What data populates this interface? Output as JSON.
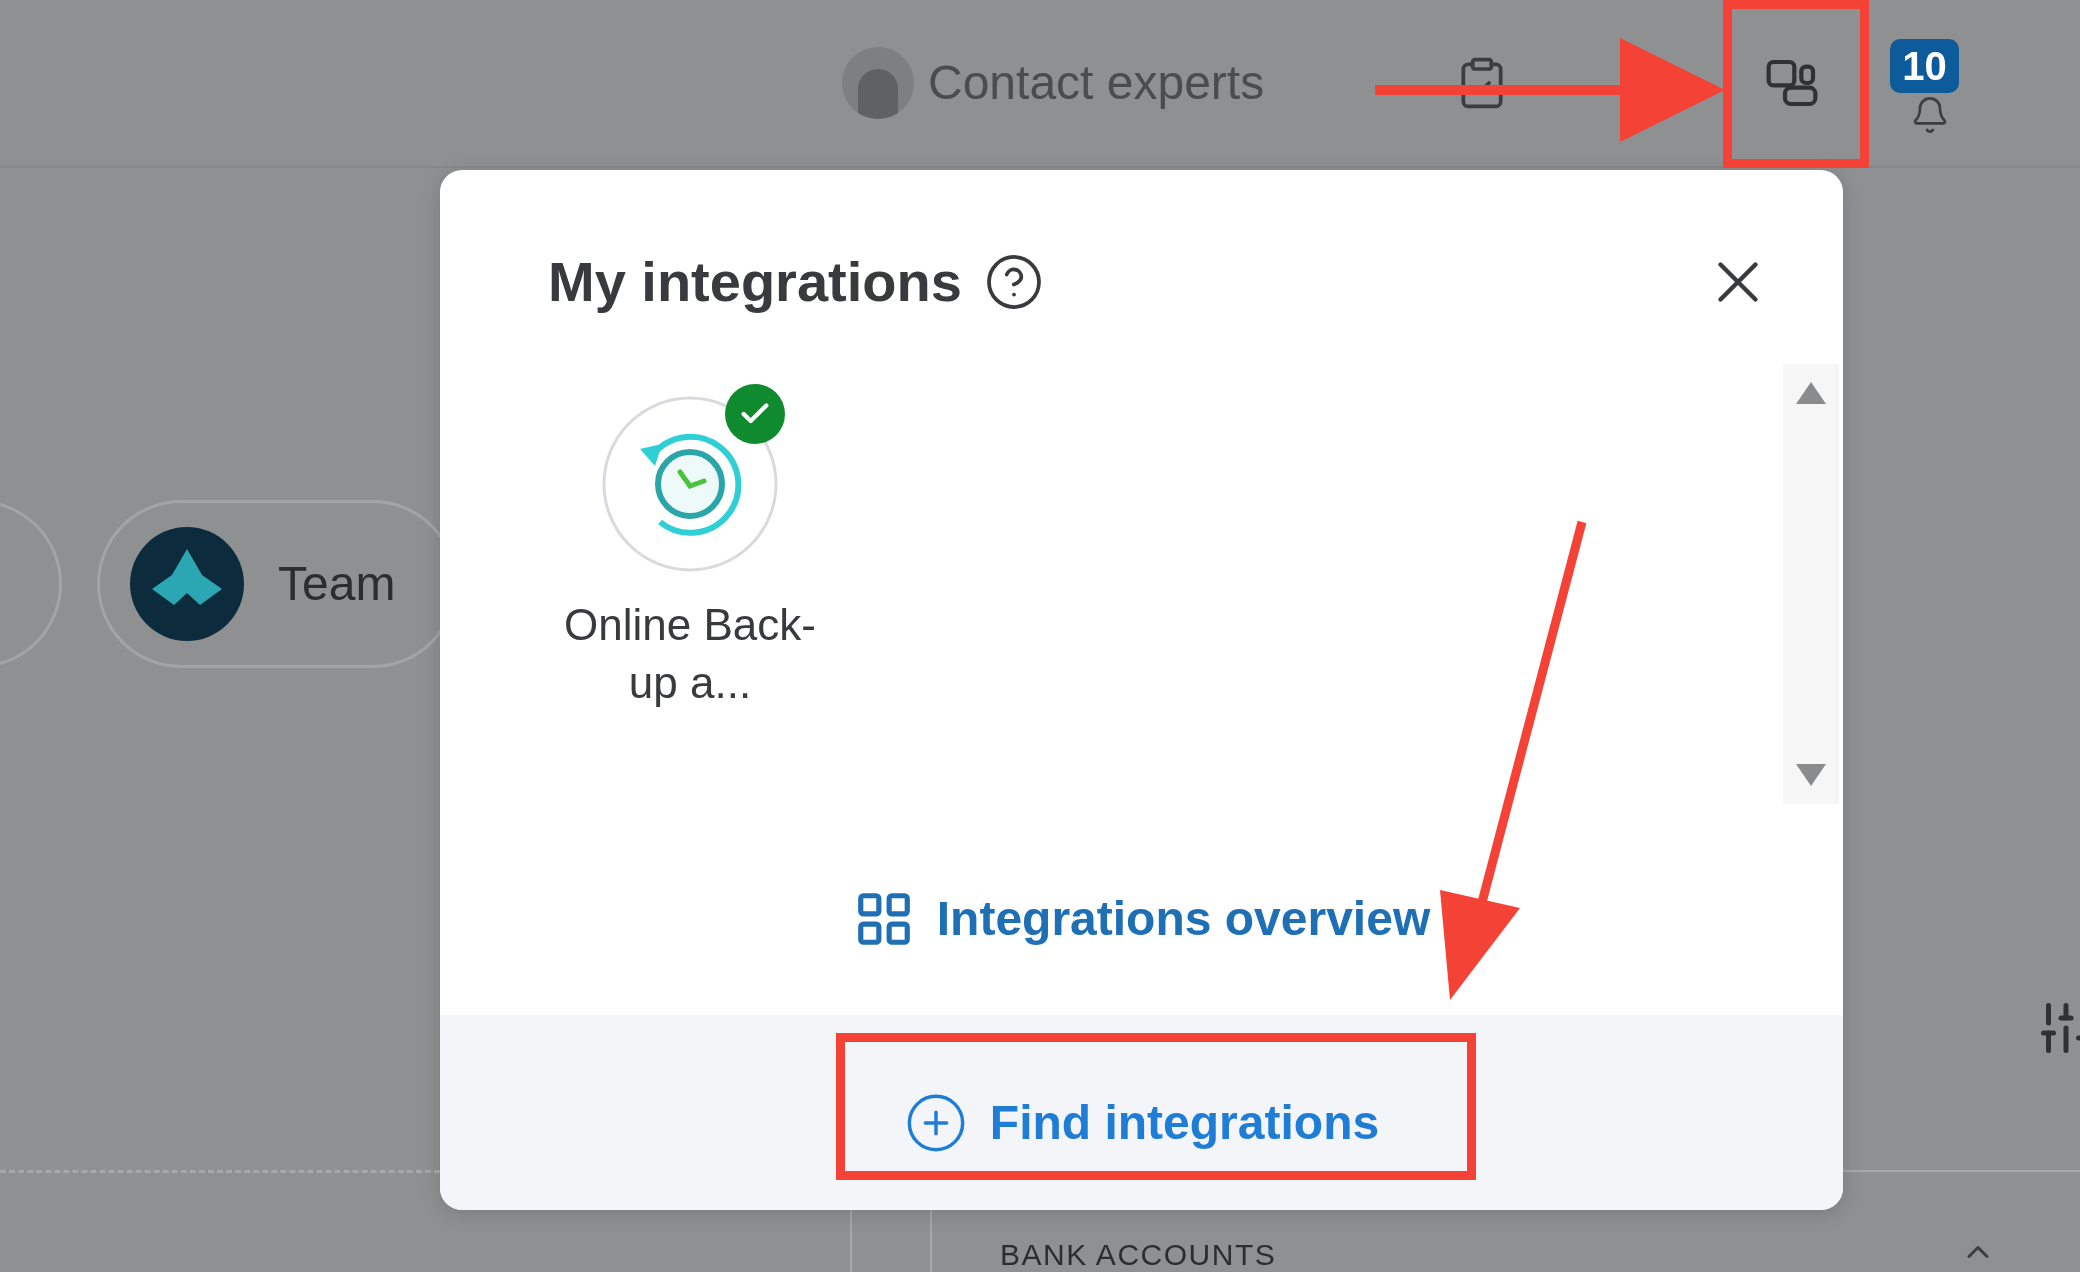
{
  "header": {
    "contact_label": "Contact experts",
    "notification_count": "10"
  },
  "background": {
    "team_label": "Team",
    "section_heading": "BANK ACCOUNTS"
  },
  "popup": {
    "title": "My integrations",
    "apps": [
      {
        "name": "Online Back-up a...",
        "connected": true
      }
    ],
    "overview_link": "Integrations overview",
    "find_button": "Find integrations"
  },
  "annotations": [
    {
      "kind": "arrow"
    },
    {
      "kind": "box"
    },
    {
      "kind": "arrow"
    },
    {
      "kind": "box"
    }
  ]
}
